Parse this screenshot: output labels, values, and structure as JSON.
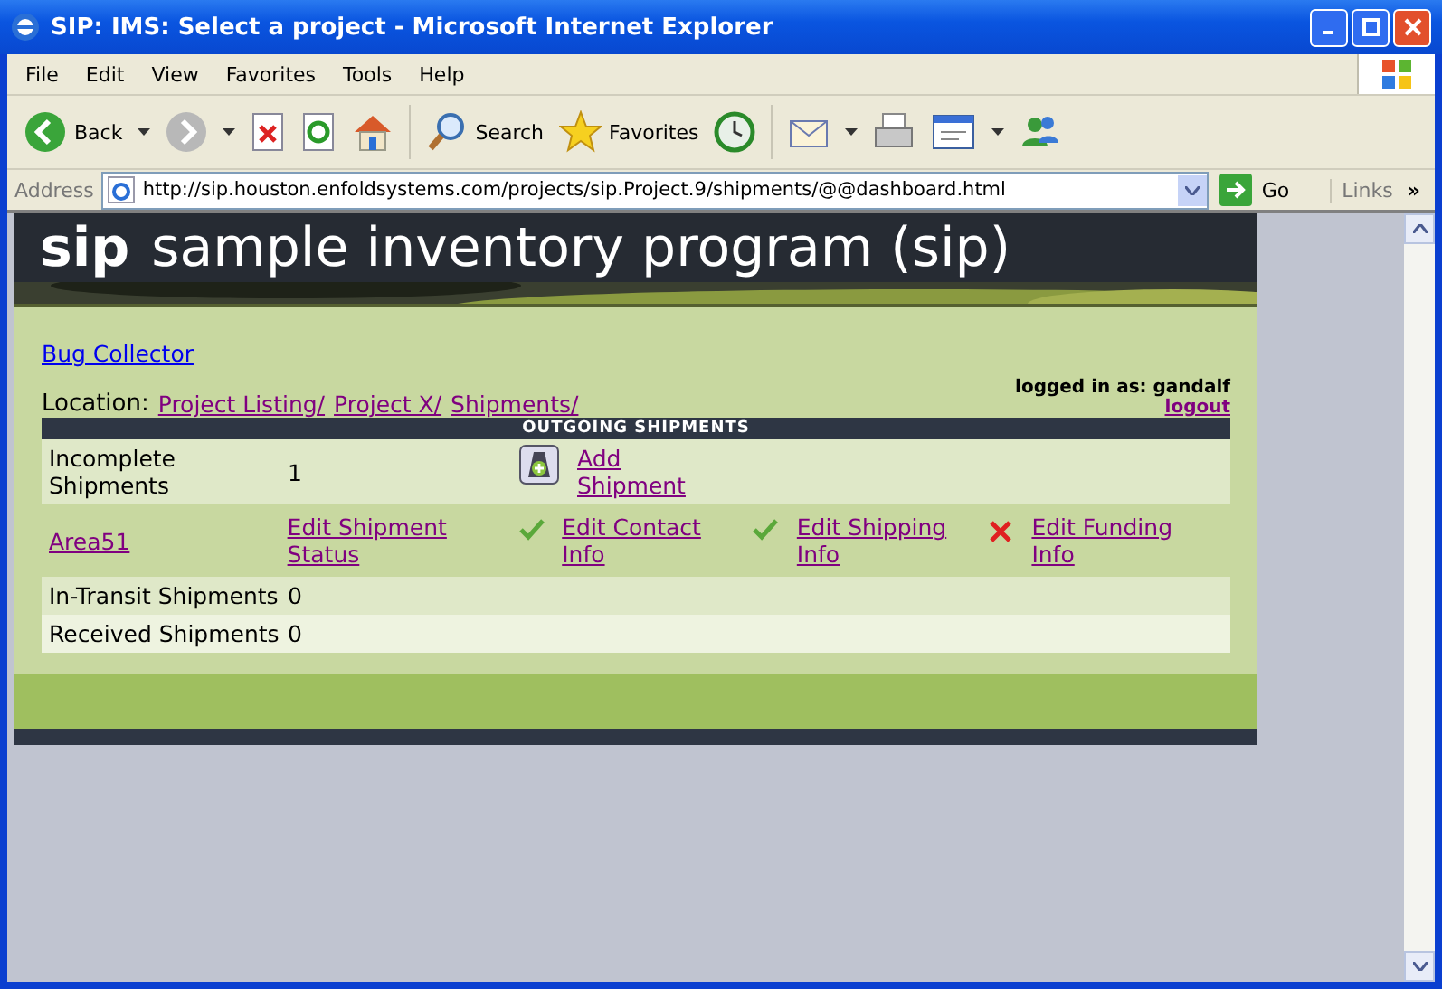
{
  "window": {
    "title": "SIP: IMS: Select a project - Microsoft Internet Explorer"
  },
  "menu": [
    "File",
    "Edit",
    "View",
    "Favorites",
    "Tools",
    "Help"
  ],
  "toolbar": [
    {
      "kind": "back",
      "label": "Back"
    },
    {
      "kind": "forward"
    },
    {
      "kind": "stop"
    },
    {
      "kind": "refresh"
    },
    {
      "kind": "home"
    },
    {
      "kind": "search",
      "label": "Search"
    },
    {
      "kind": "favorites",
      "label": "Favorites"
    },
    {
      "kind": "history"
    },
    {
      "kind": "mail"
    },
    {
      "kind": "print"
    },
    {
      "kind": "edit"
    },
    {
      "kind": "messenger"
    }
  ],
  "address": {
    "label": "Address",
    "url": "http://sip.houston.enfoldsystems.com/projects/sip.Project.9/shipments/@@dashboard.html",
    "go": "Go",
    "links": "Links",
    "more": "»"
  },
  "page": {
    "brand": "sip",
    "title": "sample inventory program (sip)",
    "project_link": "Bug Collector",
    "location_label": "Location:",
    "breadcrumbs": [
      "Project Listing/",
      "Project X/",
      "Shipments/"
    ],
    "login": "logged in as: gandalf",
    "logout": "logout",
    "section": "OUTGOING SHIPMENTS",
    "rows": [
      {
        "kind": "count",
        "label": "Incomplete Shipments",
        "count": "1",
        "action": "Add Shipment"
      },
      {
        "kind": "shipment",
        "name": "Area51",
        "status": "Edit Shipment Status",
        "tasks": [
          {
            "label": "Edit Contact Info",
            "done": true
          },
          {
            "label": "Edit Shipping Info",
            "done": true
          },
          {
            "label": "Edit Funding Info",
            "done": false
          }
        ]
      },
      {
        "kind": "count",
        "label": "In-Transit Shipments",
        "count": "0"
      },
      {
        "kind": "count",
        "label": "Received Shipments",
        "count": "0"
      }
    ]
  }
}
